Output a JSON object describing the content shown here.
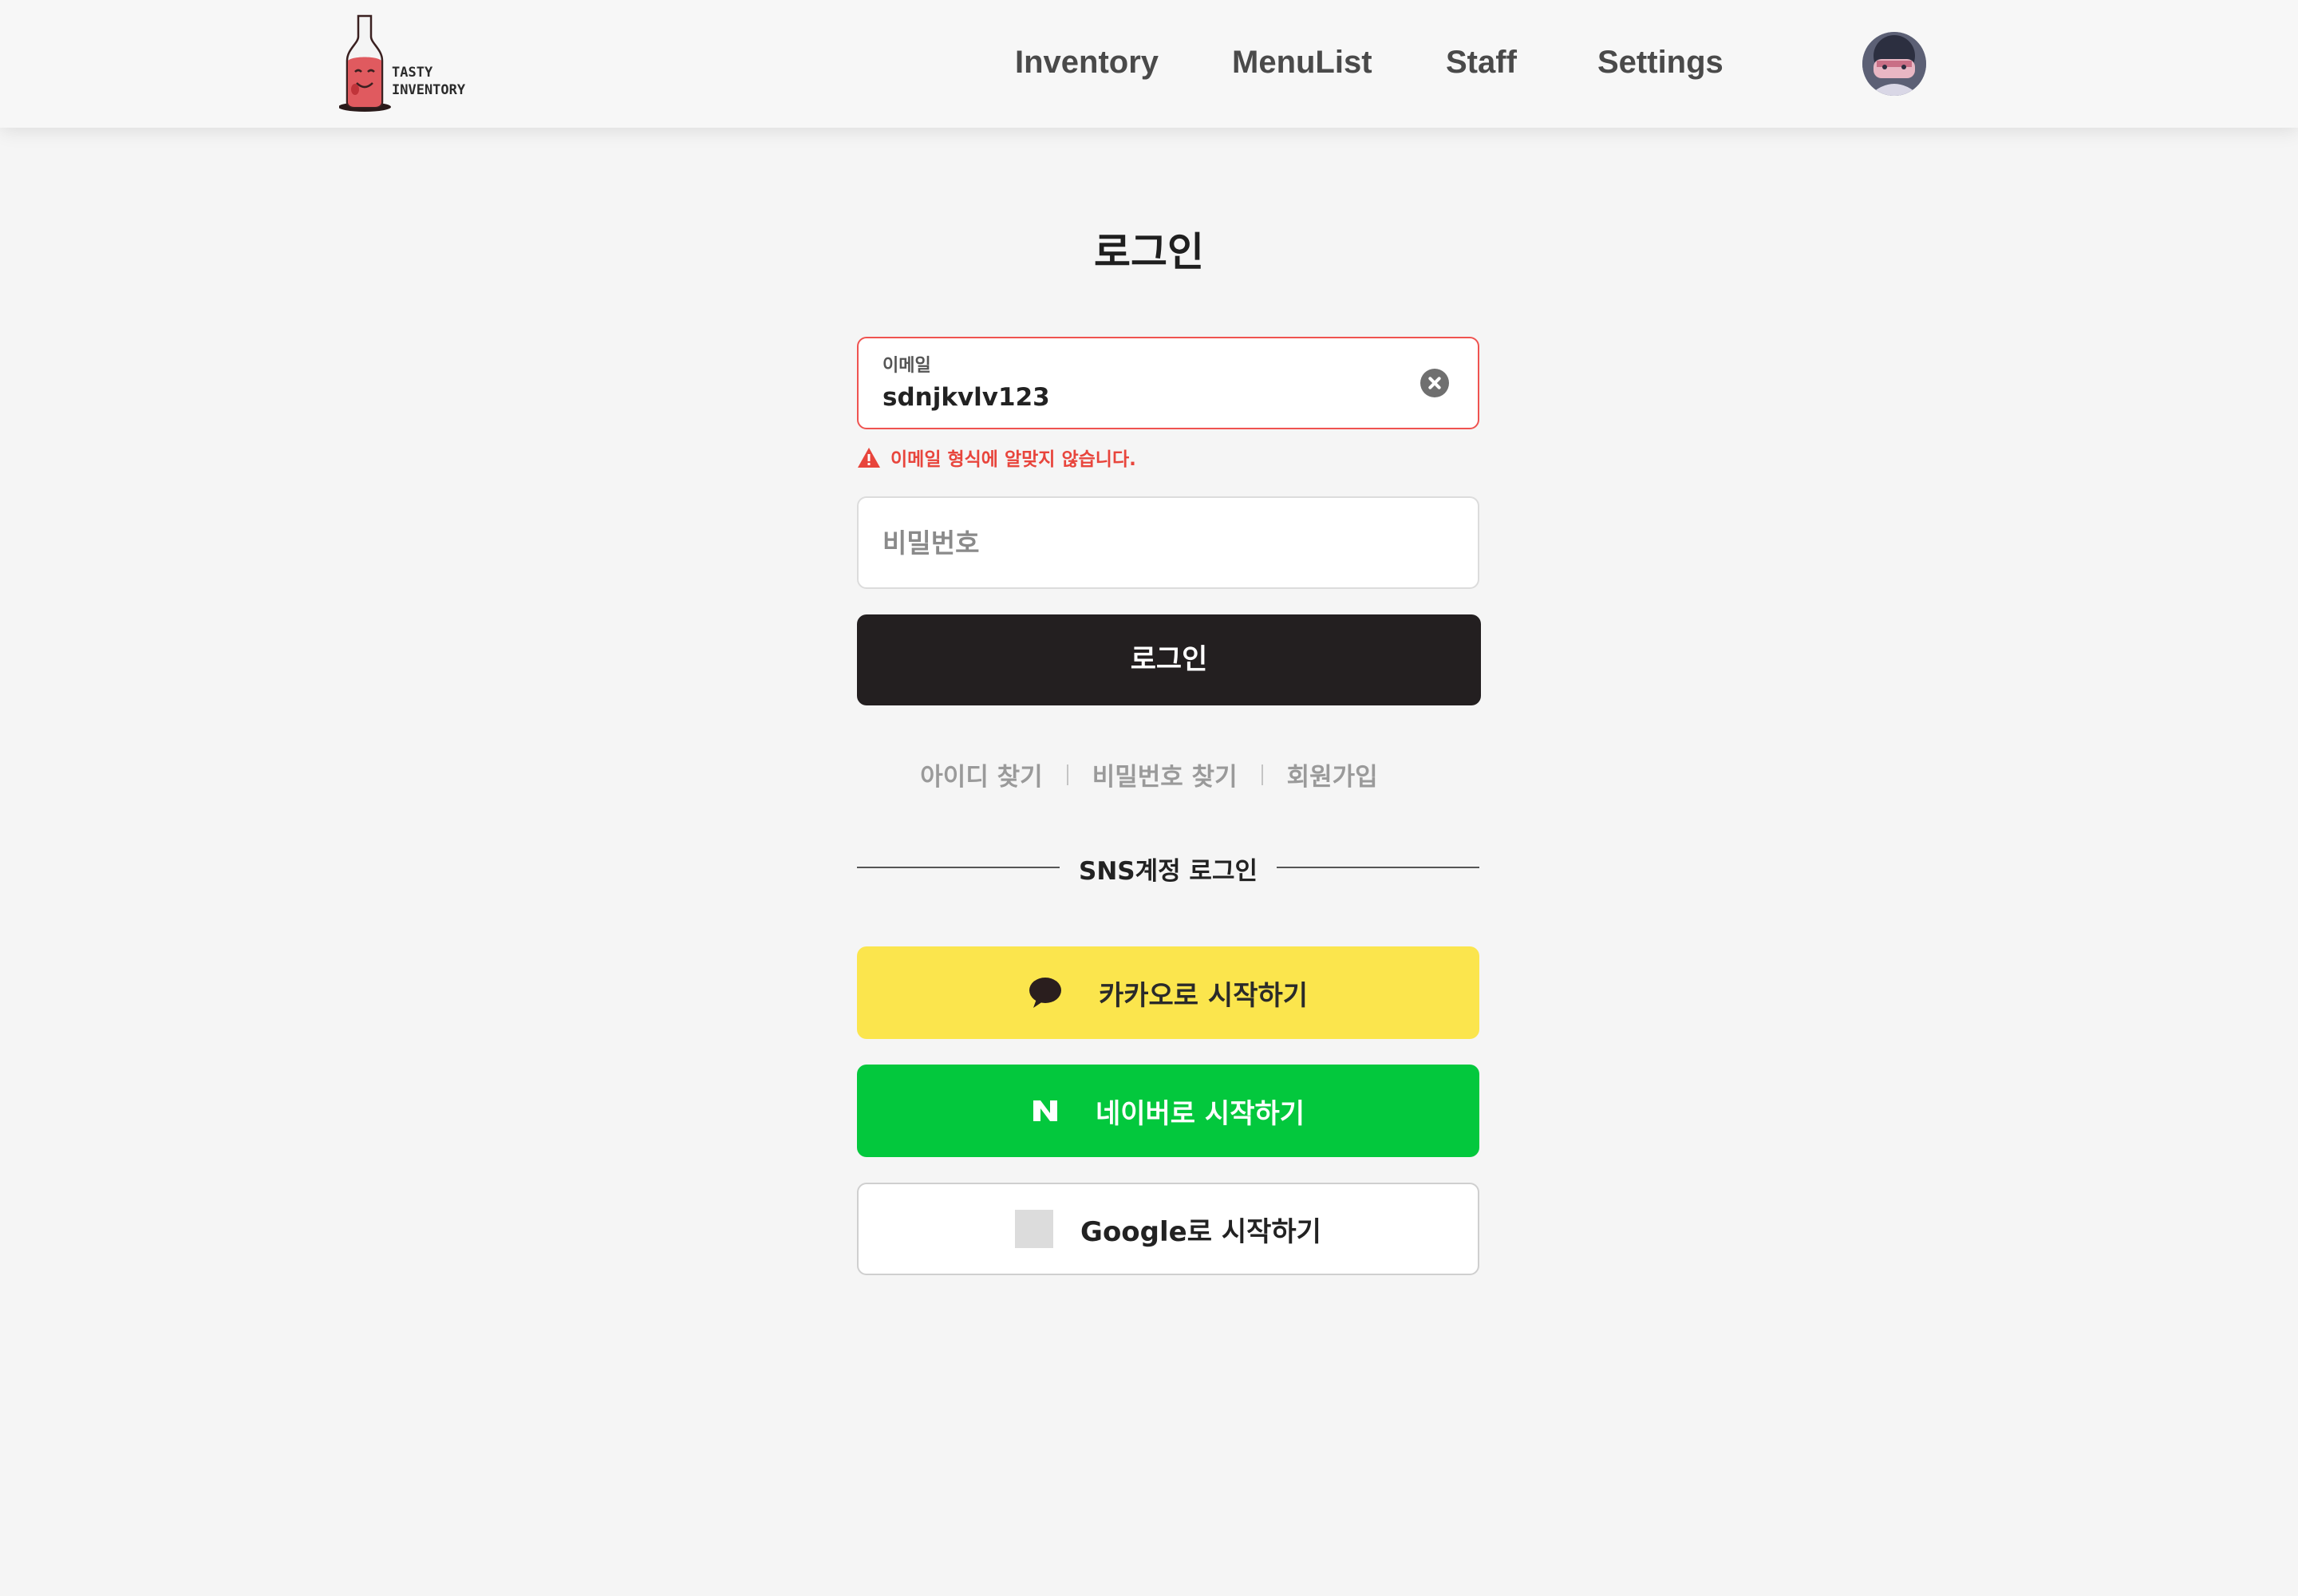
{
  "header": {
    "logo_text_line1": "TASTY",
    "logo_text_line2": "INVENTORY",
    "nav": [
      "Inventory",
      "MenuList",
      "Staff",
      "Settings"
    ]
  },
  "login": {
    "title": "로그인",
    "email": {
      "label": "이메일",
      "value": "sdnjkvlv123",
      "error": "이메일 형식에 알맞지 않습니다."
    },
    "password": {
      "placeholder": "비밀번호"
    },
    "submit_label": "로그인",
    "links": [
      "아이디 찾기",
      "비밀번호 찾기",
      "회원가입"
    ],
    "sns_divider": "SNS계정 로그인",
    "sns": {
      "kakao": "카카오로 시작하기",
      "naver": "네이버로 시작하기",
      "google": "Google로 시작하기"
    }
  },
  "colors": {
    "background": "#f5f5f5",
    "error": "#e8453c",
    "login_button": "#231f20",
    "kakao": "#fbe54d",
    "naver": "#03c83d"
  },
  "icons": [
    "bottle-logo-icon",
    "avatar-image",
    "clear-icon",
    "warning-icon",
    "kakao-chat-icon",
    "naver-n-icon",
    "google-icon"
  ]
}
